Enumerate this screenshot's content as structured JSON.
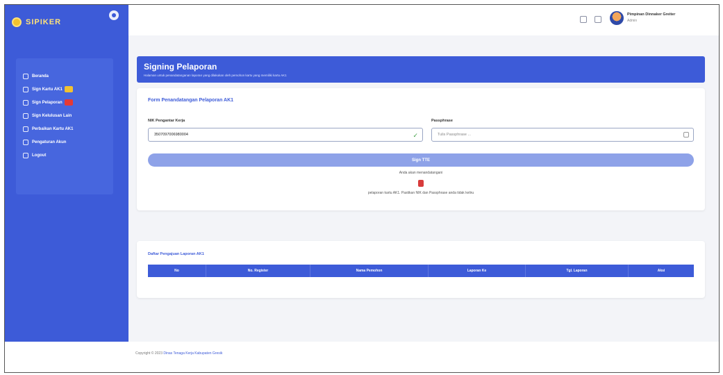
{
  "brand": {
    "name": "SIPIKER"
  },
  "sidebar": {
    "items": [
      {
        "label": "Beranda",
        "icon": "home-icon",
        "badge_color": null
      },
      {
        "label": "Sign Kartu AK1",
        "icon": "signature-icon",
        "badge_color": "#f2c230"
      },
      {
        "label": "Sign Pelaporan",
        "icon": "document-icon",
        "badge_color": "#e53935"
      },
      {
        "label": "Sign Kelulusan Lain",
        "icon": "file-icon",
        "badge_color": null
      },
      {
        "label": "Perbaikan Kartu AK1",
        "icon": "edit-icon",
        "badge_color": null
      },
      {
        "label": "Pengaturan Akun",
        "icon": "settings-icon",
        "badge_color": null
      },
      {
        "label": "Logout",
        "icon": "logout-icon",
        "badge_color": null
      }
    ]
  },
  "topbar": {
    "user_name": "Pimpinan Dinnaker Greiter",
    "user_role": "Admin"
  },
  "header": {
    "title": "Signing Pelaporan",
    "subtitle": "Halaman untuk penandatanganan laporan yang dilakukan oleh pemohon kartu yang memiliki kartu AK1"
  },
  "form": {
    "title": "Form Penandatangan Pelaporan AK1",
    "nik_label": "NIK Pengantar Kerja",
    "nik_value": "3507097006980004",
    "passphrase_label": "Passphrase",
    "passphrase_placeholder": "Tulis Passphrase ...",
    "submit_label": "Sign TTE",
    "loading_note": "Anda akan menandatangani",
    "info_note": "pelaporan kartu AK1. Pastikan NIK dan Passphrase anda tidak keliru"
  },
  "list": {
    "title": "Daftar Pengajuan Laporan AK1",
    "columns": [
      "No",
      "No. Register",
      "Nama Pemohon",
      "Laporan Ke",
      "Tgl. Laporan",
      "Aksi"
    ]
  },
  "footer": {
    "copyright": "Copyright © 2023",
    "org": "Dinas Tenaga Kerja Kabupaten Gresik"
  },
  "colors": {
    "primary": "#3d5bd8",
    "button_disabled": "#8ea2e8",
    "success": "#43a047",
    "danger": "#d83b3b"
  }
}
